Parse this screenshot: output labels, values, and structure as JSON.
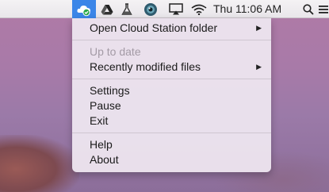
{
  "menubar": {
    "clock": "Thu 11:06 AM",
    "icons": [
      "cloud-station-icon",
      "google-drive-icon",
      "flask-icon",
      "eye-icon",
      "airplay-icon",
      "wifi-icon",
      "spotlight-search-icon",
      "notification-center-icon"
    ]
  },
  "menu": {
    "open_folder": "Open Cloud Station folder",
    "status": "Up to date",
    "recent": "Recently modified files",
    "settings": "Settings",
    "pause": "Pause",
    "exit": "Exit",
    "help": "Help",
    "about": "About"
  },
  "colors": {
    "menubar_active": "#3b86e8",
    "desktop": "#a87aa8"
  }
}
